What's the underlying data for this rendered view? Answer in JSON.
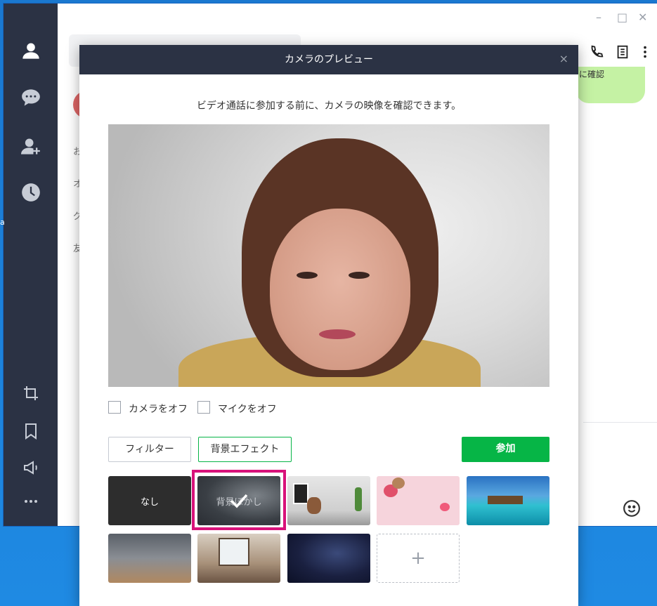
{
  "window": {
    "minimize": "–",
    "maximize": "□",
    "close": "✕"
  },
  "list_pane": {
    "partial_chars": [
      "お",
      "オ",
      "グ",
      "友"
    ]
  },
  "chat": {
    "bubble_partial_text": "に確認"
  },
  "dialog": {
    "title": "カメラのプレビュー",
    "close": "×",
    "description": "ビデオ通話に参加する前に、カメラの映像を確認できます。",
    "camera_off_label": "カメラをオフ",
    "mic_off_label": "マイクをオフ",
    "filter_button": "フィルター",
    "effect_button": "背景エフェクト",
    "join_button": "参加",
    "backgrounds": [
      {
        "label": "なし",
        "selected": false
      },
      {
        "label": "背景ぼかし",
        "selected": true
      },
      {
        "label": "",
        "selected": false
      },
      {
        "label": "",
        "selected": false
      },
      {
        "label": "",
        "selected": false
      },
      {
        "label": "",
        "selected": false
      },
      {
        "label": "",
        "selected": false
      },
      {
        "label": "",
        "selected": false
      }
    ],
    "add_button": "+"
  },
  "colors": {
    "accent_green": "#06b546",
    "selection_pink": "#d8127a",
    "sidebar": "#2b3244"
  }
}
